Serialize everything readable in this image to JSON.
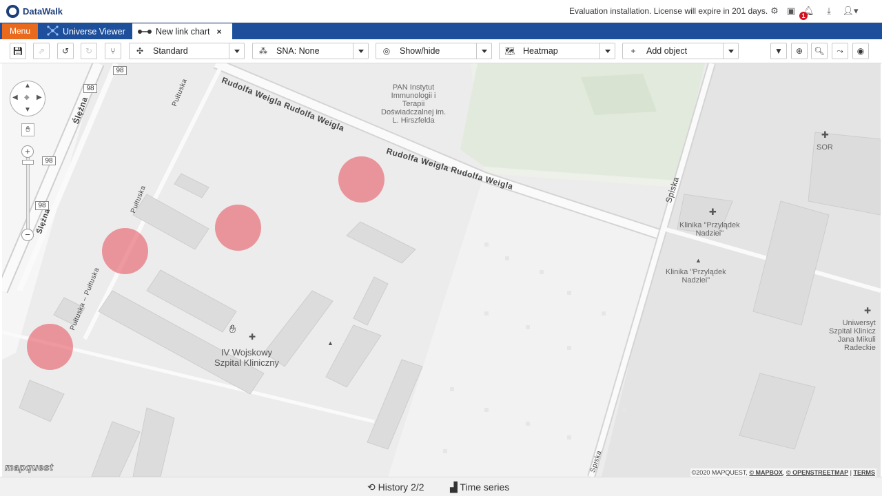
{
  "header": {
    "brand": "DataWalk",
    "license_notice": "Evaluation installation. License will expire in 201 days.",
    "notification_count": "1",
    "icons": [
      "settings-icon",
      "copy-icon",
      "bell-icon",
      "download-icon",
      "user-icon"
    ]
  },
  "tabs": {
    "menu_label": "Menu",
    "items": [
      {
        "label": "Universe Viewer",
        "icon": "universe-icon",
        "active": false
      },
      {
        "label": "New link chart",
        "icon": "link-chart-icon",
        "active": true,
        "close": "×"
      }
    ]
  },
  "toolbar": {
    "layout_dropdown": "Standard",
    "sna_dropdown": "SNA: None",
    "showhide_dropdown": "Show/hide",
    "heatmap_dropdown": "Heatmap",
    "add_object_dropdown": "Add object",
    "left_buttons": [
      "save-icon",
      "export-icon",
      "undo-icon",
      "redo-icon",
      "branch-icon"
    ],
    "right_buttons": [
      "filter-icon",
      "plus-circle-icon",
      "search-icon",
      "path-icon",
      "eye-icon"
    ]
  },
  "map": {
    "streets": {
      "rudolfa_1": "Rudolfa Weigla  Rudolfa Weigla",
      "rudolfa_2": "Rudolfa Weigla  Rudolfa Weigla",
      "spiska_1": "Spiska",
      "spiska_2": "Spiska",
      "slezna": "Ślężna",
      "pultuska_1": "Pułtuska",
      "pultuska_2": "Pułtuska",
      "pultuska_3": "Pułtuska – Pułtuska",
      "slezna_2": "Ślężna"
    },
    "route_shields": [
      "98",
      "98",
      "98",
      "98"
    ],
    "places": {
      "pan": "PAN Instytut\nImmunologii i\nTerapii\nDoświadczalnej im.\nL. Hirszfelda",
      "sor": "SOR",
      "klinika_1": "Klinika \"Przylądek\nNadziei\"",
      "klinika_2": "Klinika \"Przylądek\nNadziei\"",
      "hospital": "IV Wojskowy\nSzpital Kliniczny",
      "university": "Uniwersyt\nSzpital Klinicz\nJana Mikuli\nRadeckie"
    },
    "heat_points": 4,
    "logo": "mapquest",
    "attribution": {
      "copyright": "©2020 MAPQUEST,",
      "mapbox": "© MAPBOX",
      "osm": "© OPENSTREETMAP",
      "terms": "TERMS"
    }
  },
  "footer": {
    "history": "History 2/2",
    "time_series": "Time series"
  },
  "colors": {
    "brand": "#1d3e7a",
    "tabbar": "#1d4f9b",
    "menu": "#ea6a1d",
    "heat": "#e86a74",
    "badge": "#d0131e"
  }
}
